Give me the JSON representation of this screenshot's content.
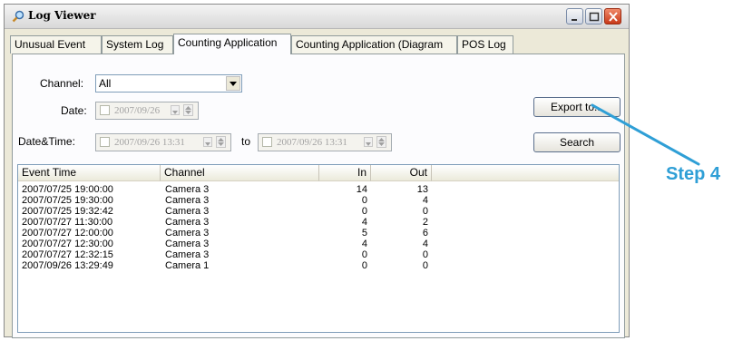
{
  "window": {
    "title": "Log Viewer"
  },
  "tabs": [
    {
      "label": "Unusual Event"
    },
    {
      "label": "System Log"
    },
    {
      "label": "Counting Application"
    },
    {
      "label": "Counting Application (Diagram"
    },
    {
      "label": "POS Log"
    }
  ],
  "filters": {
    "channel_label": "Channel:",
    "channel_value": "All",
    "date_label": "Date:",
    "date_value": "2007/09/26",
    "datetime_label": "Date&Time:",
    "datetime_from": "2007/09/26 13:31",
    "to_label": "to",
    "datetime_to": "2007/09/26 13:31"
  },
  "buttons": {
    "export": "Export to...",
    "search": "Search"
  },
  "table": {
    "columns": [
      "Event Time",
      "Channel",
      "In",
      "Out"
    ],
    "rows": [
      [
        "2007/07/25 19:00:00",
        "Camera 3",
        "14",
        "13"
      ],
      [
        "2007/07/25 19:30:00",
        "Camera 3",
        "0",
        "4"
      ],
      [
        "2007/07/25 19:32:42",
        "Camera 3",
        "0",
        "0"
      ],
      [
        "2007/07/27 11:30:00",
        "Camera 3",
        "4",
        "2"
      ],
      [
        "2007/07/27 12:00:00",
        "Camera 3",
        "5",
        "6"
      ],
      [
        "2007/07/27 12:30:00",
        "Camera 3",
        "4",
        "4"
      ],
      [
        "2007/07/27 12:32:15",
        "Camera 3",
        "0",
        "0"
      ],
      [
        "2007/09/26 13:29:49",
        "Camera 1",
        "0",
        "0"
      ]
    ]
  },
  "annotation": {
    "label": "Step 4",
    "color": "#2f9fd6"
  },
  "icons": {
    "app": "magnifier-icon",
    "minimize": "minimize-icon",
    "maximize": "maximize-icon",
    "close": "close-icon"
  }
}
